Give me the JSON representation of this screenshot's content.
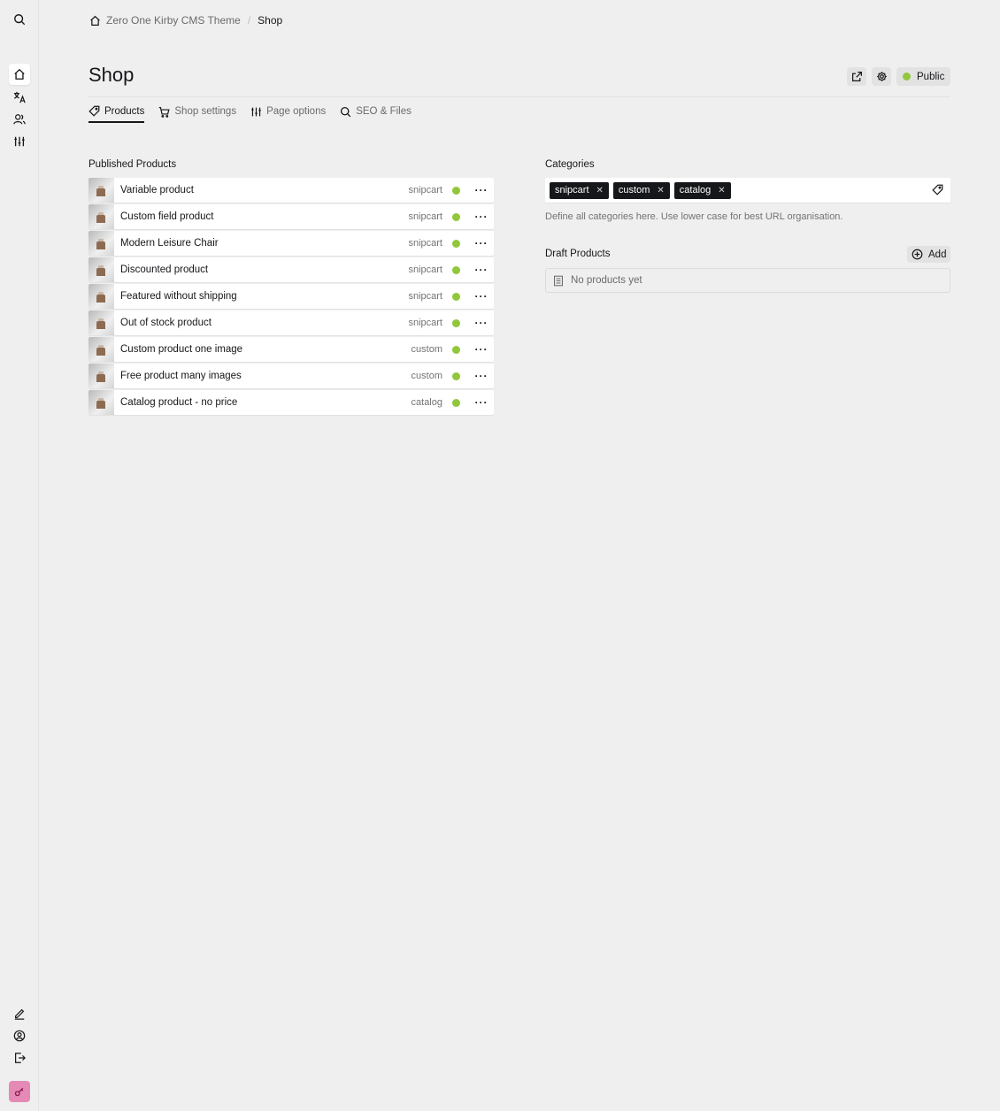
{
  "sidebar": {
    "top_items": [
      {
        "name": "search-icon"
      },
      {
        "name": "home-icon"
      },
      {
        "name": "translate-icon"
      },
      {
        "name": "users-icon"
      },
      {
        "name": "sliders-icon"
      }
    ],
    "bottom_items": [
      {
        "name": "edit-icon"
      },
      {
        "name": "account-icon"
      },
      {
        "name": "logout-icon"
      },
      {
        "name": "key-icon"
      }
    ]
  },
  "breadcrumb": {
    "site": "Zero One Kirby CMS Theme",
    "separator": "/",
    "current": "Shop"
  },
  "page": {
    "title": "Shop",
    "status_label": "Public",
    "status_color": "#91c73a"
  },
  "tabs": [
    {
      "label": "Products",
      "icon": "tag-icon",
      "active": true
    },
    {
      "label": "Shop settings",
      "icon": "cart-icon",
      "active": false
    },
    {
      "label": "Page options",
      "icon": "sliders-icon",
      "active": false
    },
    {
      "label": "SEO & Files",
      "icon": "search-icon",
      "active": false
    }
  ],
  "published": {
    "label": "Published Products",
    "items": [
      {
        "title": "Variable product",
        "info": "snipcart"
      },
      {
        "title": "Custom field product",
        "info": "snipcart"
      },
      {
        "title": "Modern Leisure Chair",
        "info": "snipcart"
      },
      {
        "title": "Discounted product",
        "info": "snipcart"
      },
      {
        "title": "Featured without shipping",
        "info": "snipcart"
      },
      {
        "title": "Out of stock product",
        "info": "snipcart"
      },
      {
        "title": "Custom product one image",
        "info": "custom"
      },
      {
        "title": "Free product many images",
        "info": "custom"
      },
      {
        "title": "Catalog product - no price",
        "info": "catalog"
      }
    ],
    "options_glyph": "···"
  },
  "categories": {
    "label": "Categories",
    "tags": [
      "snipcart",
      "custom",
      "catalog"
    ],
    "remove_glyph": "✕",
    "help": "Define all categories here. Use lower case for best URL organisation."
  },
  "drafts": {
    "label": "Draft Products",
    "add_label": "Add",
    "empty_text": "No products yet"
  }
}
